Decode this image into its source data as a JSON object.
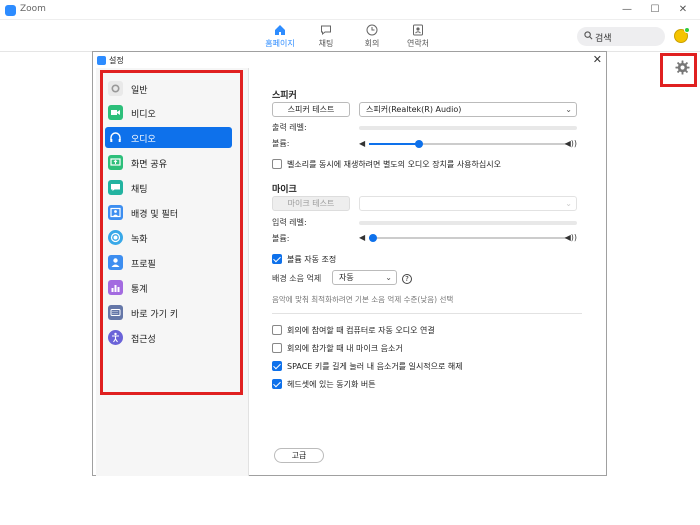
{
  "app": {
    "title": "Zoom"
  },
  "window_controls": {
    "minimize": "—",
    "maximize": "☐",
    "close": "✕"
  },
  "nav": {
    "items": [
      {
        "label": "홈페이지",
        "icon": "home-icon",
        "active": true
      },
      {
        "label": "채팅",
        "icon": "chat-icon",
        "active": false
      },
      {
        "label": "회의",
        "icon": "clock-icon",
        "active": false
      },
      {
        "label": "연락처",
        "icon": "contacts-icon",
        "active": false
      }
    ],
    "search_placeholder": "검색"
  },
  "dialog": {
    "title": "설정",
    "close": "✕",
    "sidebar": [
      {
        "label": "일반",
        "icon": "gear-icon",
        "color": "#e9e9e9",
        "active": false
      },
      {
        "label": "비디오",
        "icon": "video-icon",
        "color": "#2dbf7a",
        "active": false
      },
      {
        "label": "오디오",
        "icon": "headphones-icon",
        "color": "#0e71eb",
        "active": true
      },
      {
        "label": "화면 공유",
        "icon": "screen-share-icon",
        "color": "#2dbf7a",
        "active": false
      },
      {
        "label": "채팅",
        "icon": "chat-icon",
        "color": "#22b3a0",
        "active": false
      },
      {
        "label": "배경 및 필터",
        "icon": "background-icon",
        "color": "#3d8ef0",
        "active": false
      },
      {
        "label": "녹화",
        "icon": "record-icon",
        "color": "#38a8e8",
        "active": false
      },
      {
        "label": "프로필",
        "icon": "profile-icon",
        "color": "#3d8ef0",
        "active": false
      },
      {
        "label": "통계",
        "icon": "statistics-icon",
        "color": "#a36be0",
        "active": false
      },
      {
        "label": "바로 가기 키",
        "icon": "keyboard-icon",
        "color": "#6577a8",
        "active": false
      },
      {
        "label": "접근성",
        "icon": "accessibility-icon",
        "color": "#6a63d8",
        "active": false
      }
    ],
    "audio": {
      "speaker": {
        "title": "스피커",
        "test_button": "스피커 테스트",
        "device": "스피커(Realtek(R) Audio)",
        "output_level_label": "출력 레벨:",
        "volume_label": "볼륨:",
        "volume_value": 0.25
      },
      "separate_device": {
        "label": "벨소리를 동시에 재생하려면 별도의 오디오 장치를 사용하십시오",
        "checked": false
      },
      "mic": {
        "title": "마이크",
        "test_button": "마이크 테스트",
        "device": "",
        "input_level_label": "입력 레벨:",
        "volume_label": "볼륨:",
        "volume_value": 0.02
      },
      "auto_adjust": {
        "label": "볼륨 자동 조정",
        "checked": true
      },
      "noise": {
        "label": "배경 소음 억제",
        "value": "자동",
        "hint": "음악에 맞춰 최적화하려면 기본 소음 억제 수준(낮음) 선택"
      },
      "options": [
        {
          "label": "회의에 참여할 때 컴퓨터로 자동 오디오 연결",
          "checked": false
        },
        {
          "label": "회의에 참가할 때 내 마이크 음소거",
          "checked": false
        },
        {
          "label": "SPACE 키를 길게 눌러 내 음소거를 일시적으로 해제",
          "checked": true
        },
        {
          "label": "헤드셋에 있는 동기화 버튼",
          "checked": true
        }
      ],
      "advanced_button": "고급"
    }
  }
}
